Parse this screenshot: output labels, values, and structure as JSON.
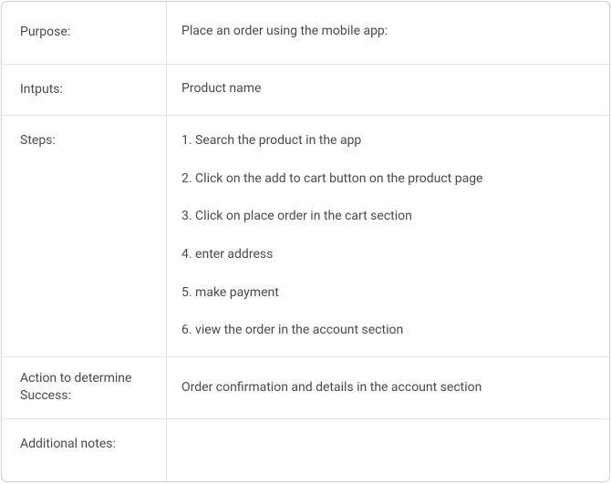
{
  "rows": {
    "purpose": {
      "label": "Purpose:",
      "value": "Place an order using the mobile app:"
    },
    "inputs": {
      "label": "Intputs:",
      "value": "Product name"
    },
    "steps": {
      "label": "Steps:",
      "items": [
        "Search the product in the app",
        "Click on the add to cart button on the product page",
        "Click on place order in the cart section",
        "enter address",
        "make payment",
        "view the order in the account section"
      ]
    },
    "success": {
      "label": "Action to determine Success:",
      "value": "Order confirmation and details in the account section"
    },
    "notes": {
      "label": "Additional notes:",
      "value": ""
    }
  }
}
